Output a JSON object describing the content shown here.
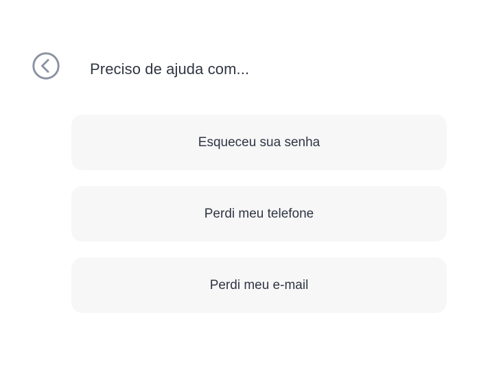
{
  "header": {
    "back_icon": "chevron-left-circle-icon",
    "title": "Preciso de ajuda com..."
  },
  "options": [
    {
      "label": "Esqueceu sua senha"
    },
    {
      "label": "Perdi meu telefone"
    },
    {
      "label": "Perdi meu e-mail"
    }
  ],
  "colors": {
    "background": "#ffffff",
    "option_background": "#f7f7f8",
    "text": "#2f3542",
    "icon": "#8a93a3"
  }
}
